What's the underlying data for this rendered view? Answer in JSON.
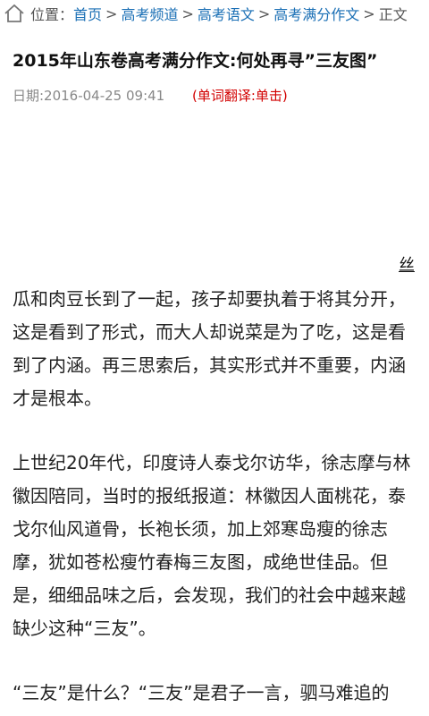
{
  "breadcrumb": {
    "prefix": "位置：",
    "items": [
      {
        "label": "首页"
      },
      {
        "label": "高考频道"
      },
      {
        "label": "高考语文"
      },
      {
        "label": "高考满分作文"
      }
    ],
    "current": "正文",
    "separator": ">"
  },
  "article": {
    "title": "2015年山东卷高考满分作文:何处再寻”三友图”",
    "date": "日期:2016-04-25 09:41",
    "translate_hint": "(单词翻译:单击)",
    "inline_char": "丝",
    "paragraphs": [
      "瓜和肉豆长到了一起，孩子却要执着于将其分开，这是看到了形式，而大人却说菜是为了吃，这是看到了内涵。再三思索后，其实形式并不重要，内涵才是根本。",
      "上世纪20年代，印度诗人泰戈尔访华，徐志摩与林徽因陪同，当时的报纸报道：林徽因人面桃花，泰戈尔仙风道骨，长袍长须，加上郊寒岛瘦的徐志摩，犹如苍松瘦竹春梅三友图，成绝世佳品。但是，细细品味之后，会发现，我们的社会中越来越缺少这种“三友”。",
      "“三友”是什么？“三友”是君子一言，驷马难追的"
    ]
  },
  "colors": {
    "link": "#1a6fb5",
    "hint": "#d20000",
    "muted": "#888888",
    "text": "#222222"
  },
  "icons": {
    "home": "home-icon"
  }
}
